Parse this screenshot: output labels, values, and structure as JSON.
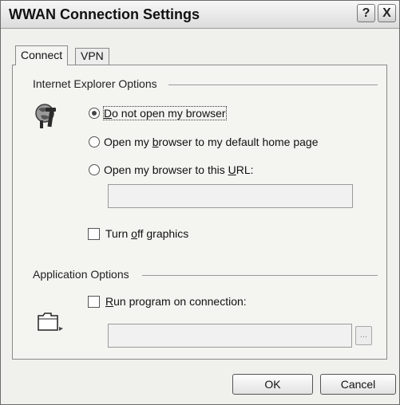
{
  "window": {
    "title": "WWAN Connection Settings",
    "help_button": "?",
    "close_button": "X"
  },
  "tabs": [
    {
      "label": "Connect",
      "active": true
    },
    {
      "label": "VPN",
      "active": false
    }
  ],
  "ie_options": {
    "group_label": "Internet Explorer Options",
    "icon": "globe-tools-icon",
    "radios": [
      {
        "pre": "",
        "key": "D",
        "post": "o not open my browser",
        "checked": true
      },
      {
        "pre": "Open my ",
        "key": "b",
        "post": "rowser to my default home page",
        "checked": false
      },
      {
        "pre": "Open my browser to this ",
        "key": "U",
        "post": "RL:",
        "checked": false
      }
    ],
    "url_value": "",
    "turn_off_graphics": {
      "pre": "Turn ",
      "key": "o",
      "post": "ff graphics",
      "checked": false
    }
  },
  "app_options": {
    "group_label": "Application Options",
    "icon": "folder-program-icon",
    "run_program": {
      "pre": "",
      "key": "R",
      "post": "un program on connection:",
      "checked": false
    },
    "program_path_value": "",
    "browse_label": "..."
  },
  "buttons": {
    "ok": "OK",
    "cancel": "Cancel"
  }
}
